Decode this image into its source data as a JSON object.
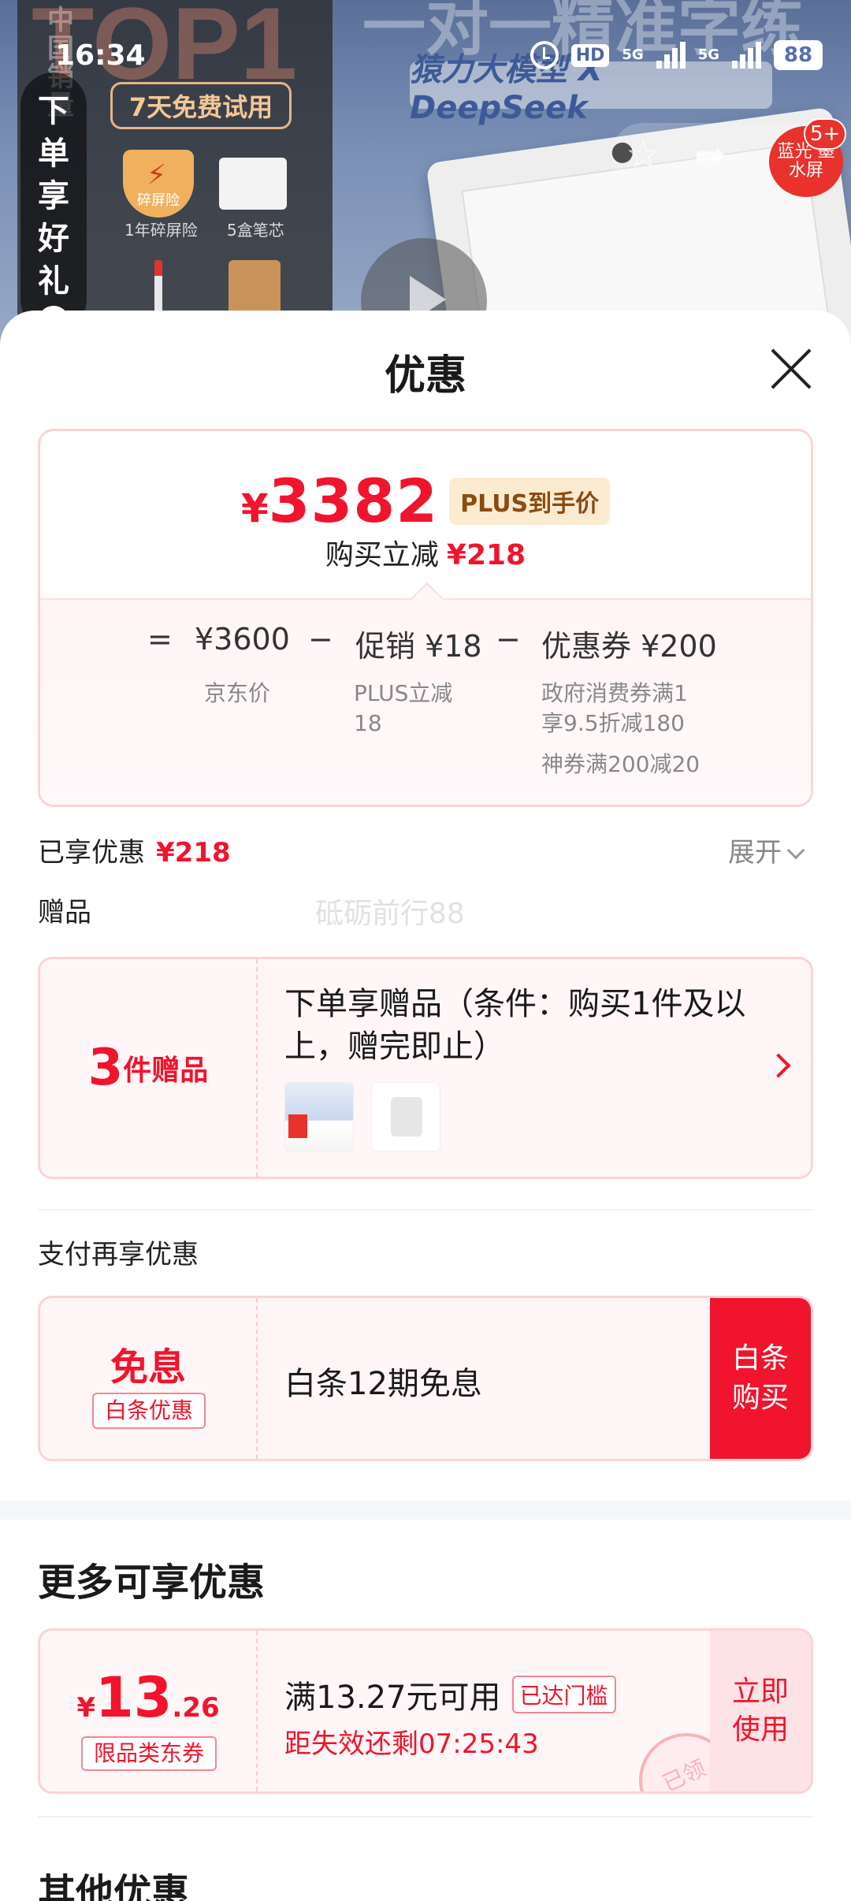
{
  "status_bar": {
    "time": "16:34",
    "hd": "HD",
    "network1": "5G",
    "network2": "5G",
    "battery": "88"
  },
  "background": {
    "country_badge": "中国 销量",
    "top1": "TOP1",
    "headline": "一对一精准字练",
    "ai_banner": "猿力大模型 X DeepSeek",
    "vertical_promo": [
      "下",
      "单",
      "享",
      "好",
      "礼"
    ],
    "vertical_arrow": ">",
    "trial": "7天免费试用",
    "shield_text": "碎屏险",
    "shield_label": "1年碎屏险",
    "box_label": "5盒笔芯",
    "promo_badge": "蓝光 墨水屏",
    "badge_count": "5+"
  },
  "sheet": {
    "title": "优惠",
    "price_card": {
      "currency": "¥",
      "price": "3382",
      "plus_tag": "PLUS到手价",
      "reduce_label": "购买立减",
      "reduce_value": "¥218",
      "equals": "=",
      "minus": "−",
      "jd_price": "¥3600",
      "jd_price_label": "京东价",
      "promo_label": "促销 ¥18",
      "promo_desc": "PLUS立减\n18",
      "coupon_label": "优惠券 ¥200",
      "coupon_desc1": "政府消费券满1\n享9.5折减180",
      "coupon_desc2": "神券满200减20"
    },
    "enjoyed_label": "已享优惠",
    "enjoyed_value": "¥218",
    "expand_label": "展开",
    "gifts_section": "赠品",
    "watermark": "砥砺前行88",
    "gift_card": {
      "count": "3",
      "unit": "件赠品",
      "title": "下单享赠品（条件：购买1件及以上，赠完即止）"
    },
    "pay_section": "支付再享优惠",
    "pay_card": {
      "main": "免息",
      "tag": "白条优惠",
      "desc": "白条12期免息",
      "button": "白条\n购买"
    },
    "more_title": "更多可享优惠",
    "coupon": {
      "currency": "¥",
      "amount_int": "13",
      "amount_dec": ".26",
      "tag": "限品类东券",
      "condition": "满13.27元可用",
      "reached": "已达门槛",
      "countdown": "距失效还剩07:25:43",
      "stamp": "已领",
      "button": "立即\n使用"
    },
    "other_title": "其他优惠"
  },
  "colors": {
    "accent": "#f0142d",
    "plus_bg": "#fbecd1",
    "card_border": "#fbd4d6",
    "card_bg": "#fff6f7"
  }
}
